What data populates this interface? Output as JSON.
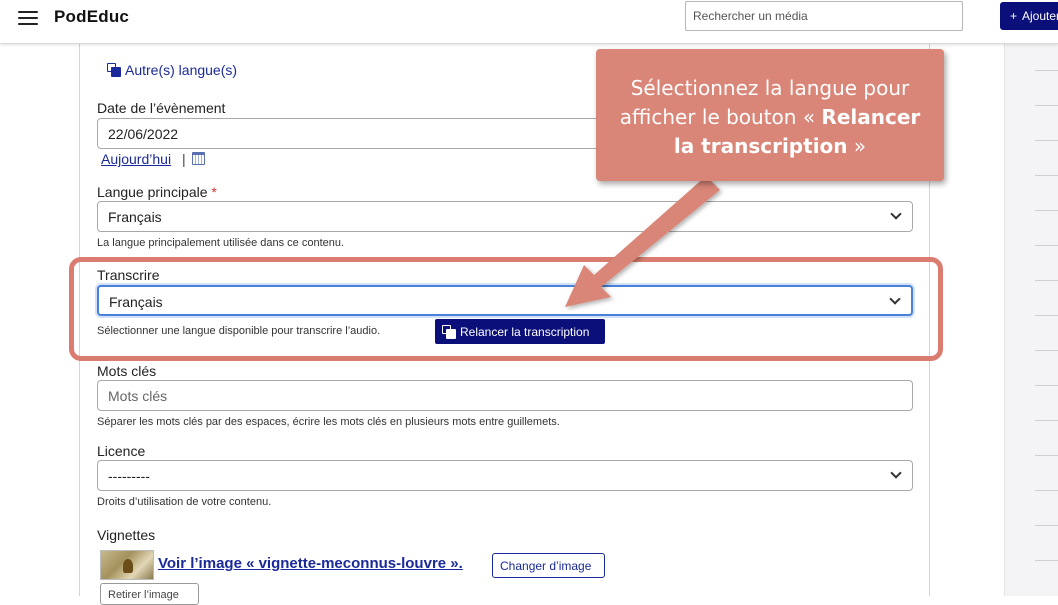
{
  "header": {
    "brand": "PodEduc",
    "search_placeholder": "Rechercher un média",
    "add_label": "Ajouter"
  },
  "form": {
    "other_languages_link": "Autre(s) langue(s)",
    "event_date": {
      "label": "Date de l’évènement",
      "value": "22/06/2022",
      "today_link": "Aujourd’hui",
      "separator": "|"
    },
    "main_language": {
      "label": "Langue principale",
      "required_mark": "*",
      "value": "Français",
      "help": "La langue principalement utilisée dans ce contenu."
    },
    "transcribe": {
      "label": "Transcrire",
      "value": "Français",
      "help": "Sélectionner une langue disponible pour transcrire l’audio.",
      "relaunch_button": "Relancer la transcription"
    },
    "keywords": {
      "label": "Mots clés",
      "placeholder": "Mots clés",
      "help": "Séparer les mots clés par des espaces, écrire les mots clés en plusieurs mots entre guillemets."
    },
    "license": {
      "label": "Licence",
      "value": "---------",
      "help": "Droits d’utilisation de votre contenu."
    },
    "thumbnails": {
      "label": "Vignettes",
      "view_link": "Voir l’image « vignette-meconnus-louvre ».",
      "change_button": "Changer d’image",
      "remove_button": "Retirer l’image"
    }
  },
  "callout": {
    "line1": "Sélectionnez la langue pour",
    "line2_plain": "afficher le bouton « ",
    "line2_bold": "Relancer",
    "line3_bold": "la transcription",
    "line3_plain": " »"
  },
  "colors": {
    "accent": "#0a0f7a",
    "callout": "#d98577",
    "highlight": "#da7d70",
    "link": "#1a2a9a"
  }
}
